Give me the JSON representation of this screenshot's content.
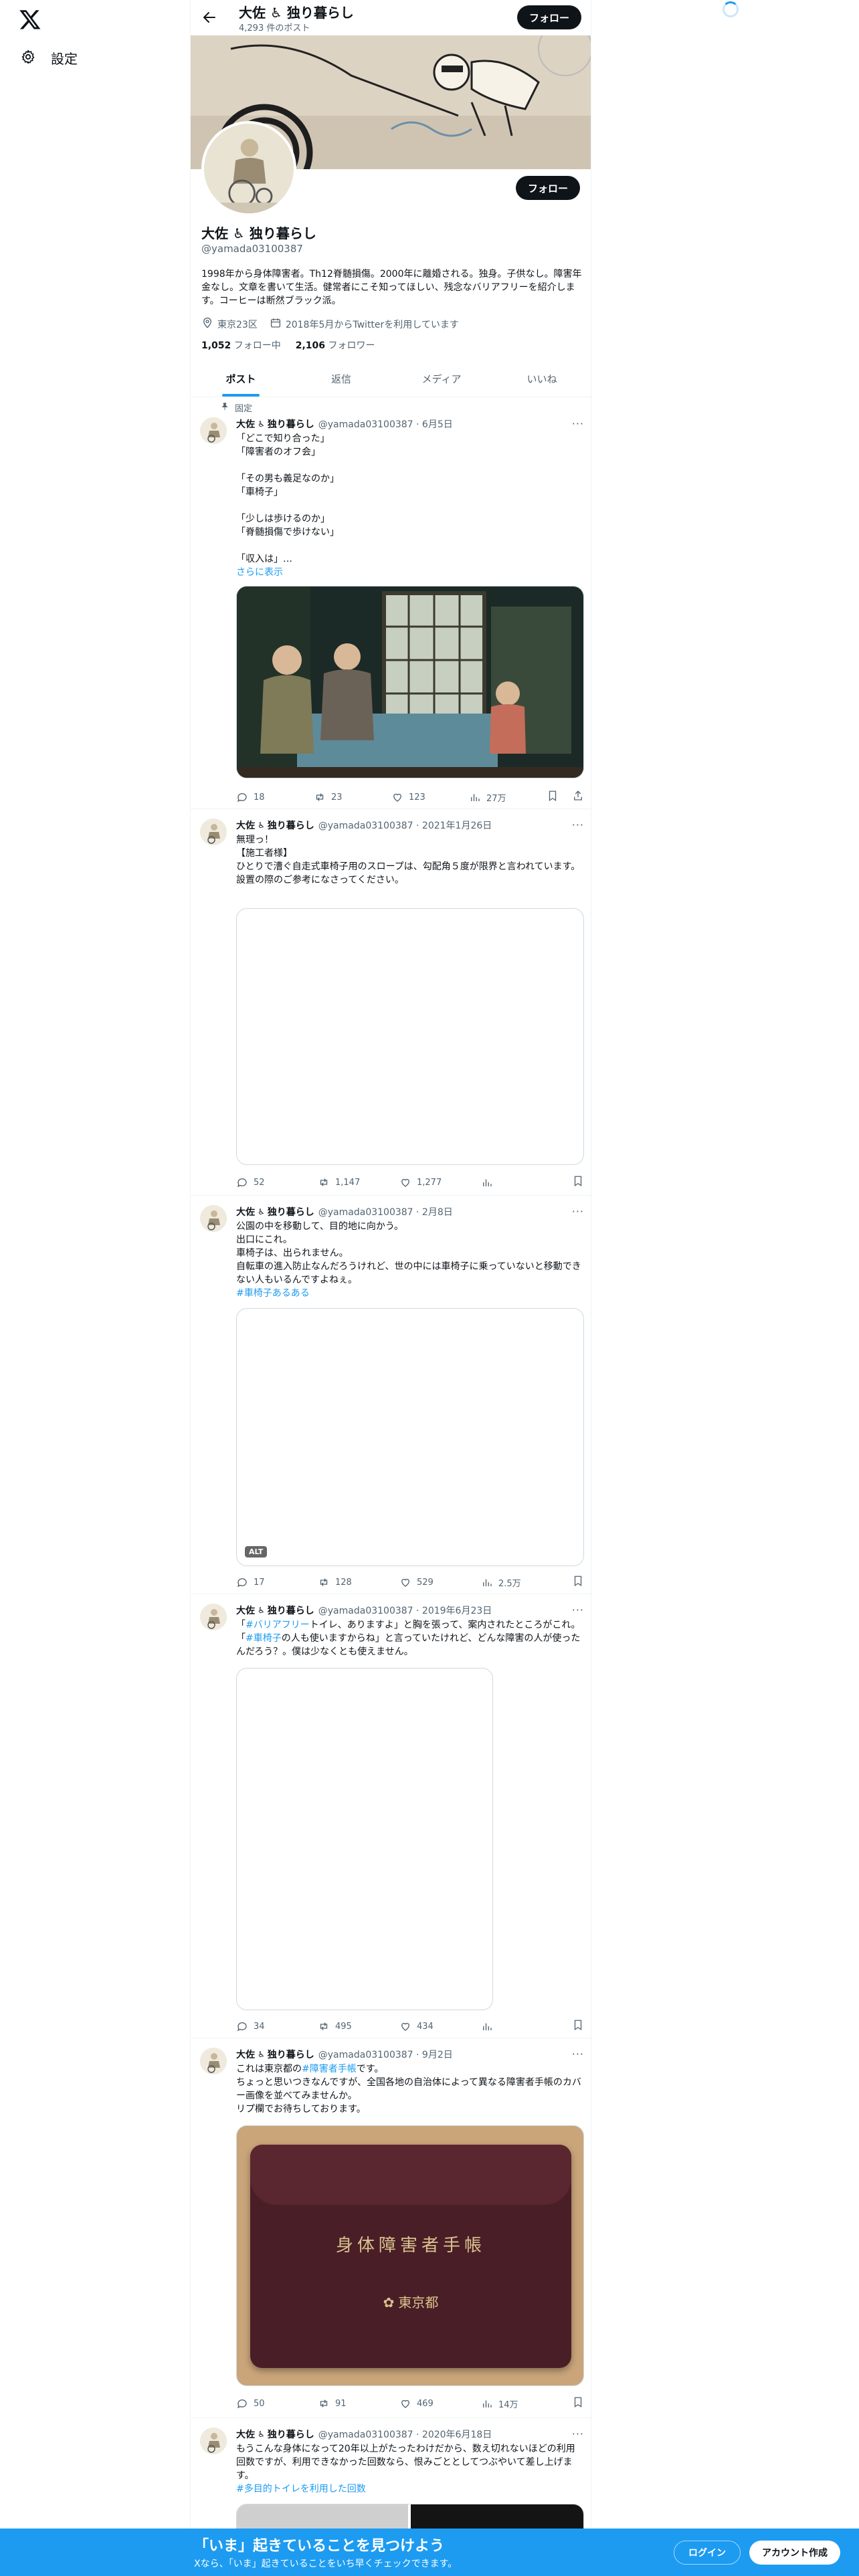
{
  "nav": {
    "settings_label": "設定"
  },
  "header": {
    "name": "大佐 ♿ 独り暮らし",
    "post_count": "4,293 件のポスト",
    "follow_label": "フォロー"
  },
  "profile": {
    "name": "大佐 ♿ 独り暮らし",
    "handle": "@yamada03100387",
    "bio": "1998年から身体障害者。Th12脊髄損傷。2000年に離婚される。独身。子供なし。障害年金なし。文章を書いて生活。健常者にこそ知ってほしい、残念なバリアフリーを紹介します。コーヒーは断然ブラック派。",
    "location": "東京23区",
    "joined": "2018年5月からTwitterを利用しています",
    "following_count": "1,052",
    "following_label": "フォロー中",
    "followers_count": "2,106",
    "followers_label": "フォロワー",
    "follow_label": "フォロー"
  },
  "tabs": [
    "ポスト",
    "返信",
    "メディア",
    "いいね"
  ],
  "posts": [
    {
      "pinned_label": "固定",
      "name": "大佐",
      "name_suffix": "独り暮らし",
      "handle_date": "@yamada03100387 · 6月5日",
      "text": "「どこで知り合った」\n「障害者のオフ会」\n\n「その男も義足なのか」\n「車椅子」\n\n「少しは歩けるのか」\n「脊髄損傷で歩けない」\n\n「収入は」…",
      "show_more": "さらに表示",
      "replies": "18",
      "reposts": "23",
      "likes": "123",
      "views": "27万"
    },
    {
      "name": "大佐",
      "name_suffix": "独り暮らし",
      "handle_date": "@yamada03100387 · 2021年1月26日",
      "text": "無理っ！\n【施工者様】\nひとりで漕ぐ自走式車椅子用のスロープは、勾配角５度が限界と言われています。\n設置の際のご参考になさってください。",
      "replies": "52",
      "reposts": "1,147",
      "likes": "1,277"
    },
    {
      "name": "大佐",
      "name_suffix": "独り暮らし",
      "handle_date": "@yamada03100387 · 2月8日",
      "text": "公園の中を移動して、目的地に向かう。\n出口にこれ。\n車椅子は、出られません。\n自転車の進入防止なんだろうけれど、世の中には車椅子に乗っていないと移動できない人もいるんですよねぇ。",
      "hashtag": "#車椅子あるある",
      "alt_label": "ALT",
      "replies": "17",
      "reposts": "128",
      "likes": "529",
      "views": "2.5万"
    },
    {
      "name": "大佐",
      "name_suffix": "独り暮らし",
      "handle_date": "@yamada03100387 · 2019年6月23日",
      "text_a": "「",
      "tag_a": "#バリアフリー",
      "text_b": "トイレ、ありますよ」と胸を張って、案内されたところがこれ。「",
      "tag_b": "#車椅子",
      "text_c": "の人も使いますからね」と言っていたけれど、どんな障害の人が使ったんだろう？。僕は少なくとも使えません。",
      "replies": "34",
      "reposts": "495",
      "likes": "434"
    },
    {
      "name": "大佐",
      "name_suffix": "独り暮らし",
      "handle_date": "@yamada03100387 · 9月2日",
      "text_a": "これは東京都の",
      "tag_a": "#障害者手帳",
      "text_b": "です。\nちょっと思いつきなんですが、全国各地の自治体によって異なる障害者手帳のカバー画像を並べてみませんか。\nリプ欄でお待ちしております。",
      "card_title": "身体障害者手帳",
      "card_issuer": "東京都",
      "replies": "50",
      "reposts": "91",
      "likes": "469",
      "views": "14万"
    },
    {
      "name": "大佐",
      "name_suffix": "独り暮らし",
      "handle_date": "@yamada03100387 · 2020年6月18日",
      "text": "もうこんな身体になって20年以上がたったわけだから、数え切れないほどの利用回数ですが、利用できなかった回数なら、恨みごととしてつぶやいて差し上げます。",
      "hashtag": "#多目的トイレを利用した回数"
    }
  ],
  "bottombar": {
    "title": "「いま」起きていることを見つけよう",
    "subtitle": "Xなら、「いま」起きていることをいち早くチェックできます。",
    "login_label": "ログイン",
    "signup_label": "アカウント作成"
  }
}
